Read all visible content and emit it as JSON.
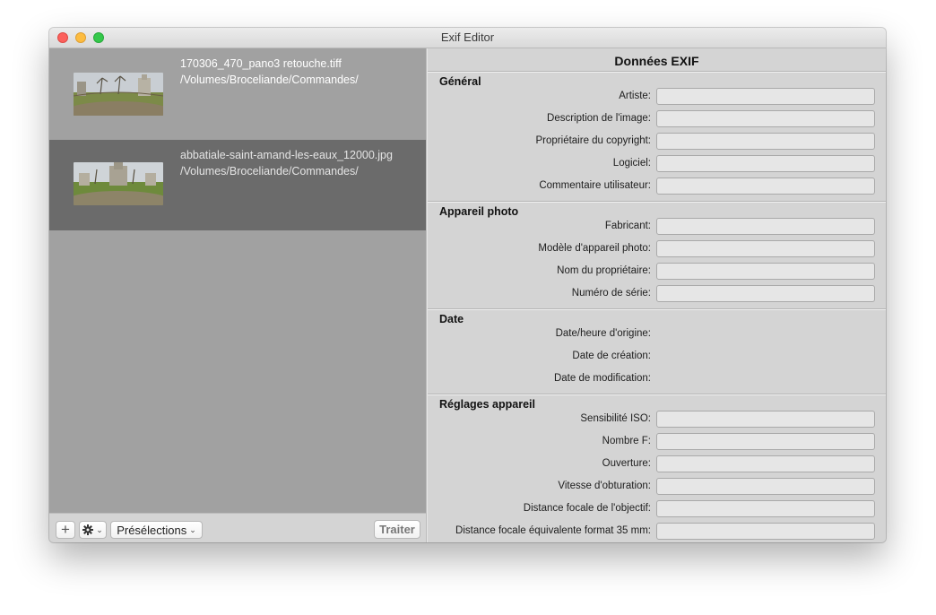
{
  "window": {
    "title": "Exif Editor"
  },
  "files": [
    {
      "name": "170306_470_pano3 retouche.tiff",
      "path": "/Volumes/Broceliande/Commandes/",
      "selected": false
    },
    {
      "name": "abbatiale-saint-amand-les-eaux_12000.jpg",
      "path": "/Volumes/Broceliande/Commandes/",
      "selected": true
    }
  ],
  "toolbar": {
    "add_label": "+",
    "gear_icon": "gear-icon",
    "presets_label": "Présélections",
    "process_label": "Traiter"
  },
  "exif": {
    "title": "Données EXIF",
    "general": {
      "title": "Général",
      "fields": [
        {
          "label": "Artiste:",
          "value": ""
        },
        {
          "label": "Description de l'image:",
          "value": ""
        },
        {
          "label": "Propriétaire du copyright:",
          "value": ""
        },
        {
          "label": "Logiciel:",
          "value": ""
        },
        {
          "label": "Commentaire utilisateur:",
          "value": ""
        }
      ]
    },
    "camera": {
      "title": "Appareil photo",
      "fields": [
        {
          "label": "Fabricant:",
          "value": ""
        },
        {
          "label": "Modèle d'appareil photo:",
          "value": ""
        },
        {
          "label": "Nom du propriétaire:",
          "value": ""
        },
        {
          "label": "Numéro de série:",
          "value": ""
        }
      ]
    },
    "date": {
      "title": "Date",
      "fields": [
        {
          "label": "Date/heure d'origine:"
        },
        {
          "label": "Date de création:"
        },
        {
          "label": "Date de modification:"
        }
      ]
    },
    "settings": {
      "title": "Réglages appareil",
      "fields": [
        {
          "label": "Sensibilité ISO:",
          "value": ""
        },
        {
          "label": "Nombre F:",
          "value": ""
        },
        {
          "label": "Ouverture:",
          "value": ""
        },
        {
          "label": "Vitesse d'obturation:",
          "value": ""
        },
        {
          "label": "Distance focale de l'objectif:",
          "value": ""
        },
        {
          "label": "Distance focale équivalente format 35 mm:",
          "value": ""
        }
      ]
    }
  }
}
